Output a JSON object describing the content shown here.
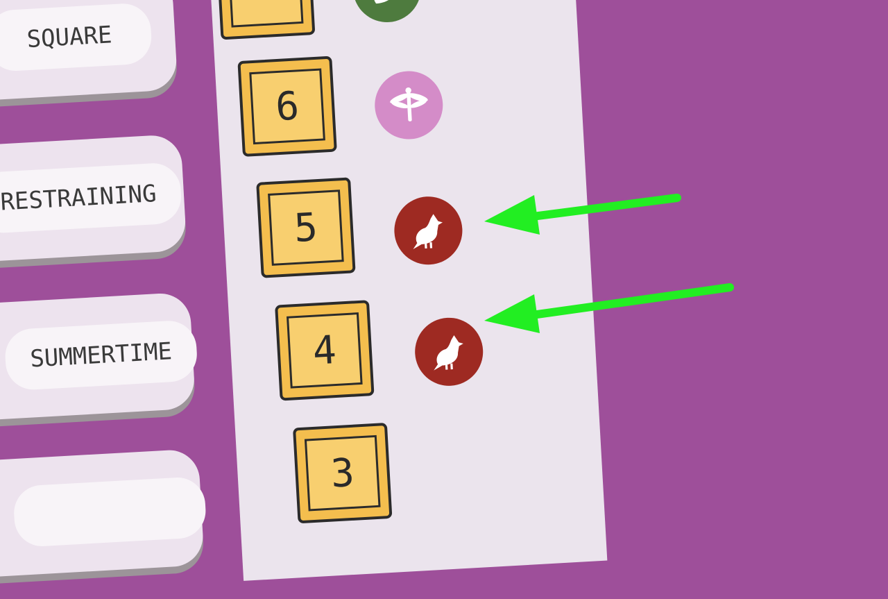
{
  "words": [
    {
      "label": "SQUARE"
    },
    {
      "label": "RESTRAINING"
    },
    {
      "label": "SUMMERTIME"
    },
    {
      "label": ""
    }
  ],
  "tiles": [
    {
      "number": ""
    },
    {
      "number": "6"
    },
    {
      "number": "5"
    },
    {
      "number": "4"
    },
    {
      "number": "3"
    }
  ],
  "tokens": [
    {
      "icon": "leaf-icon",
      "color": "#4E7B3E"
    },
    {
      "icon": "dragonfly-icon",
      "color": "#D48CC8"
    },
    {
      "icon": "cardinal-bird-icon",
      "color": "#9E2A22"
    },
    {
      "icon": "cardinal-bird-icon",
      "color": "#9E2A22"
    }
  ],
  "colors": {
    "background": "#9E4F9A",
    "strip": "#EBE4ED",
    "tile": "#F4BE4E",
    "arrow": "#22EE22"
  }
}
